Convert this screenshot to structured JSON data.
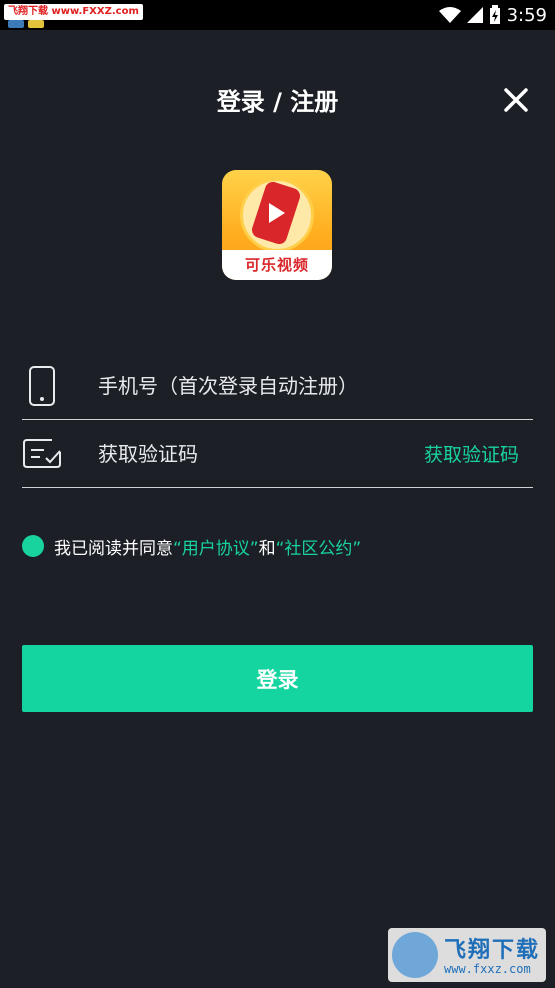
{
  "status_bar": {
    "watermark": "飞翔下载 www.FXXZ.com",
    "time": "3:59"
  },
  "header": {
    "title": "登录 / 注册",
    "close_icon": "close-icon"
  },
  "logo": {
    "text": "可乐视频"
  },
  "form": {
    "phone_placeholder": "手机号（首次登录自动注册）",
    "code_placeholder": "获取验证码",
    "get_code_label": "获取验证码"
  },
  "agreement": {
    "prefix": "我已阅读并同意",
    "user_agreement": "“用户协议”",
    "conjunction": "和",
    "community_rules": "“社区公约”"
  },
  "login": {
    "label": "登录"
  },
  "watermark": {
    "brand": "飞翔下载",
    "url": "www.fxxz.com"
  },
  "colors": {
    "background": "#1c2026",
    "accent": "#14d4a0",
    "divider": "#cfd2d6"
  }
}
